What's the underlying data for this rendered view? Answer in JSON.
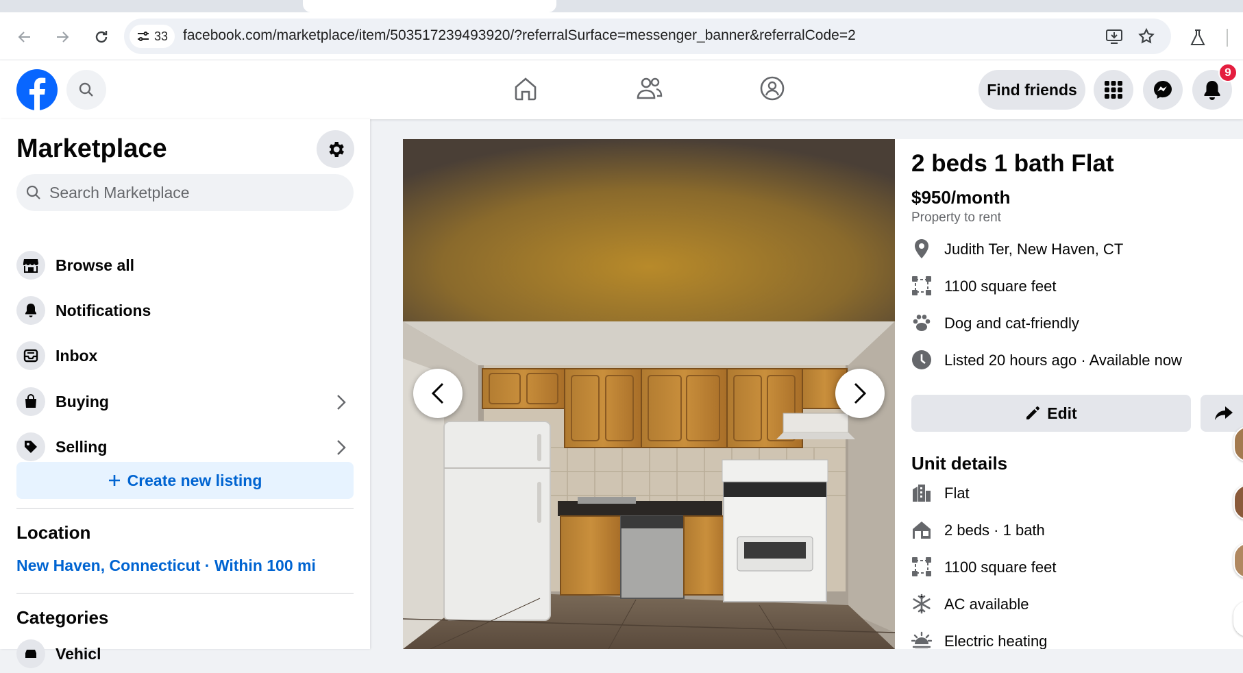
{
  "browser": {
    "site_info_count": "33",
    "url": "facebook.com/marketplace/item/503517239493920/?referralSurface=messenger_banner&referralCode=2"
  },
  "fb_header": {
    "find_friends": "Find friends",
    "notification_count": "9"
  },
  "sidebar": {
    "title": "Marketplace",
    "search_placeholder": "Search Marketplace",
    "items": [
      {
        "label": "Browse all",
        "icon": "storefront-icon"
      },
      {
        "label": "Notifications",
        "icon": "bell-icon"
      },
      {
        "label": "Inbox",
        "icon": "inbox-icon"
      },
      {
        "label": "Buying",
        "icon": "shopping-bag-icon"
      },
      {
        "label": "Selling",
        "icon": "price-tag-icon"
      }
    ],
    "create_listing": "Create new listing",
    "location_heading": "Location",
    "location_value": "New Haven, Connecticut · Within 100 mi",
    "categories_heading": "Categories",
    "first_category_partial": "Vehicl"
  },
  "listing": {
    "title": "2 beds 1 bath Flat",
    "price": "$950/month",
    "category": "Property to rent",
    "info": [
      {
        "text": "Judith Ter, New Haven, CT",
        "icon": "location-pin-icon"
      },
      {
        "text": "1100 square feet",
        "icon": "area-icon"
      },
      {
        "text": "Dog and cat-friendly",
        "icon": "paw-icon"
      },
      {
        "text": "Listed 20 hours ago · Available now",
        "icon": "clock-icon"
      }
    ],
    "edit_label": "Edit",
    "unit_details_heading": "Unit details",
    "unit_details": [
      {
        "text": "Flat",
        "icon": "building-icon"
      },
      {
        "text": "2 beds · 1 bath",
        "icon": "house-icon"
      },
      {
        "text": "1100 square feet",
        "icon": "area-icon"
      },
      {
        "text": "AC available",
        "icon": "snowflake-icon"
      },
      {
        "text": "Electric heating",
        "icon": "heating-icon"
      }
    ]
  },
  "colors": {
    "fb_blue": "#0866ff",
    "link_blue": "#0064d1",
    "badge_red": "#e41e3f"
  }
}
